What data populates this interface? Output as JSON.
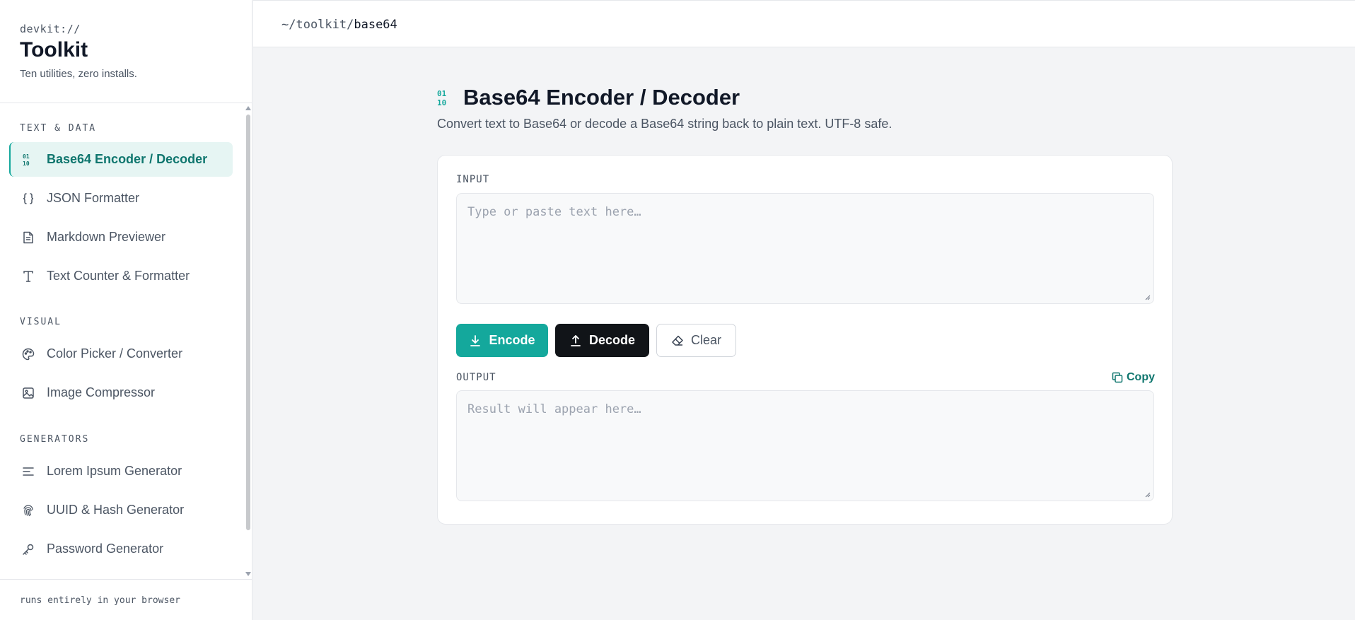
{
  "sidebar": {
    "brand": {
      "eyebrow": "devkit://",
      "title": "Toolkit",
      "subtitle": "Ten utilities, zero installs."
    },
    "sections": [
      {
        "label": "TEXT & DATA",
        "items": [
          {
            "label": "Base64 Encoder / Decoder",
            "icon": "binary-icon",
            "active": true
          },
          {
            "label": "JSON Formatter",
            "icon": "braces-icon"
          },
          {
            "label": "Markdown Previewer",
            "icon": "file-text-icon"
          },
          {
            "label": "Text Counter & Formatter",
            "icon": "type-icon"
          }
        ]
      },
      {
        "label": "VISUAL",
        "items": [
          {
            "label": "Color Picker / Converter",
            "icon": "palette-icon"
          },
          {
            "label": "Image Compressor",
            "icon": "image-icon"
          }
        ]
      },
      {
        "label": "GENERATORS",
        "items": [
          {
            "label": "Lorem Ipsum Generator",
            "icon": "align-left-icon"
          },
          {
            "label": "UUID & Hash Generator",
            "icon": "fingerprint-icon"
          },
          {
            "label": "Password Generator",
            "icon": "key-icon"
          }
        ]
      }
    ],
    "footer": "runs entirely in your browser"
  },
  "topbar": {
    "crumb_prefix": "~/toolkit/",
    "crumb_current": "base64"
  },
  "main": {
    "title": "Base64 Encoder / Decoder",
    "title_icon_text": "01 10",
    "description": "Convert text to Base64 or decode a Base64 string back to plain text. UTF-8 safe.",
    "input_label": "INPUT",
    "input_placeholder": "Type or paste text here…",
    "input_value": "",
    "encode_label": "Encode",
    "decode_label": "Decode",
    "clear_label": "Clear",
    "output_label": "OUTPUT",
    "copy_label": "Copy",
    "output_placeholder": "Result will appear here…",
    "output_value": ""
  },
  "colors": {
    "accent": "#14a89c",
    "accent_dark": "#0f766e",
    "dark_button": "#111418",
    "active_bg": "#e6f5f3"
  }
}
